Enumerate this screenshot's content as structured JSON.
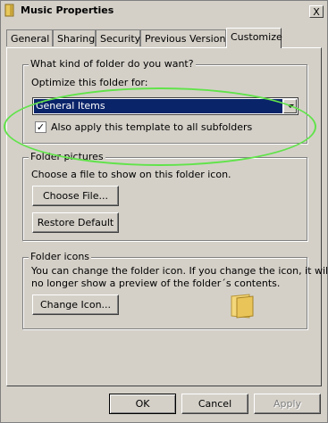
{
  "window": {
    "title": "Music Properties",
    "close_label": "X"
  },
  "tabs": [
    {
      "label": "General"
    },
    {
      "label": "Sharing"
    },
    {
      "label": "Security"
    },
    {
      "label": "Previous Versions"
    },
    {
      "label": "Customize"
    }
  ],
  "folder_type": {
    "legend": "What kind of folder do you want?",
    "optimize_label": "Optimize this folder for:",
    "selected_value": "General Items",
    "apply_subfolders_label": "Also apply this template to all subfolders",
    "apply_subfolders_checked": true
  },
  "folder_pictures": {
    "legend": "Folder pictures",
    "description": "Choose a file to show on this folder icon.",
    "choose_file_label": "Choose File...",
    "restore_default_label": "Restore Default"
  },
  "folder_icons": {
    "legend": "Folder icons",
    "description_line1": "You can change the folder icon. If you change the icon, it will",
    "description_line2": "no longer show a preview of the folder´s contents.",
    "change_icon_label": "Change Icon..."
  },
  "buttons": {
    "ok": "OK",
    "cancel": "Cancel",
    "apply": "Apply"
  },
  "colors": {
    "selection": "#0a246a",
    "highlight_ellipse": "#61e34a",
    "dialog_bg": "#d4d0c8"
  }
}
